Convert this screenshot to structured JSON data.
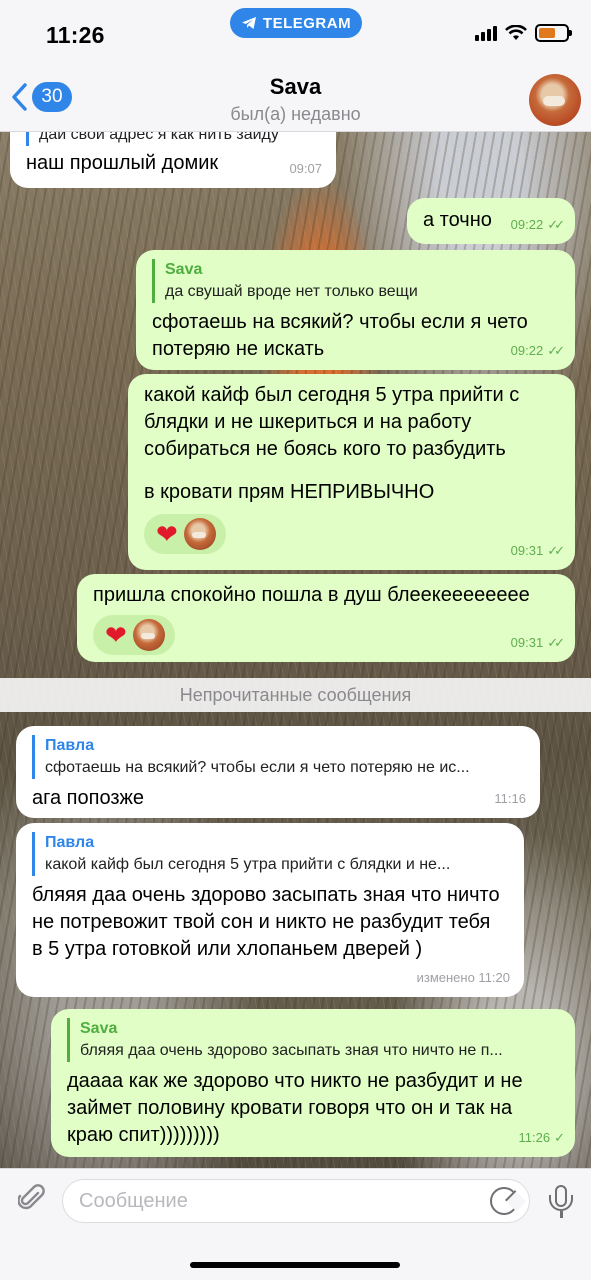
{
  "status": {
    "time": "11:26",
    "app_pill": "TELEGRAM"
  },
  "header": {
    "back_count": "30",
    "title": "Sava",
    "subtitle": "был(а) недавно"
  },
  "messages": [
    {
      "reply_text": "даи свой адрес я как нить заиду",
      "text": "наш прошлый домик",
      "time": "09:07"
    },
    {
      "text": "а точно",
      "time": "09:22"
    },
    {
      "reply_name": "Sava",
      "reply_text": "да свушай вроде нет только вещи",
      "text": "сфотаешь на всякий? чтобы если я чето потеряю не искать",
      "time": "09:22"
    },
    {
      "text": "какой кайф был сегодня 5 утра прийти с блядки и не шкериться и на работу собираться не боясь кого то разбудить",
      "text2": "в кровати прям НЕПРИВЫЧНО",
      "time": "09:31",
      "reaction": "❤"
    },
    {
      "text": "пришла спокойно пошла в душ блеекееееееее",
      "time": "09:31",
      "reaction": "❤"
    },
    {
      "reply_name": "Павла",
      "reply_text": "сфотаешь на всякий? чтобы если я чето потеряю не ис...",
      "text": "ага попозже",
      "time": "11:16"
    },
    {
      "reply_name": "Павла",
      "reply_text": "какой кайф был сегодня 5 утра прийти с блядки и не...",
      "text": "бляяя даа очень здорово засыпать зная что ничто не потревожит твой сон и никто не разбудит тебя в 5 утра готовкой или хлопаньем дверей )",
      "time": "изменено 11:20"
    },
    {
      "reply_name": "Sava",
      "reply_text": "бляяя даа очень здорово засыпать зная что ничто не п...",
      "text": "даааа как же здорово что никто не разбудит и не займет половину кровати говоря что он и так на краю спит)))))))))",
      "time": "11:26"
    }
  ],
  "unread_label": "Непрочитанные сообщения",
  "input": {
    "placeholder": "Сообщение"
  },
  "colors": {
    "accent": "#2f86e8",
    "outgoing_bubble": "#e1fec6",
    "incoming_bubble": "#ffffff"
  }
}
